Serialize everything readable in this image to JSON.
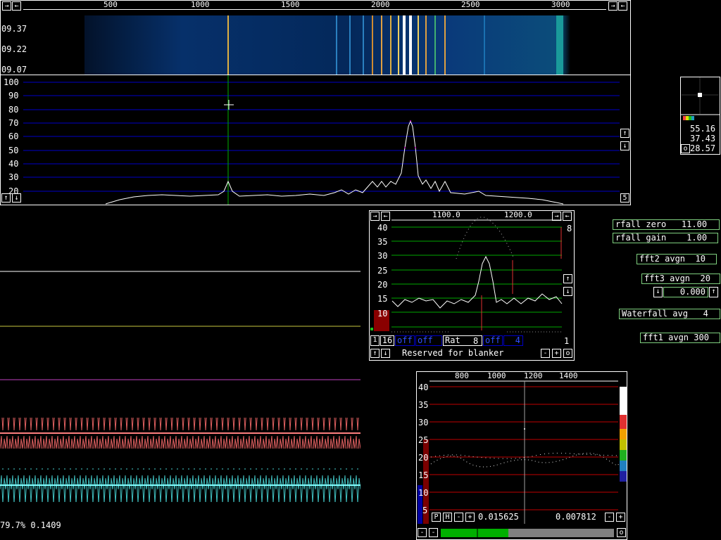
{
  "main_spectrum": {
    "freq_ticks": [
      "500",
      "1000",
      "1500",
      "2000",
      "2500",
      "3000"
    ],
    "time_labels": [
      "09.37",
      "09.22",
      "09.07"
    ],
    "y_ticks": [
      "100",
      "90",
      "80",
      "70",
      "60",
      "50",
      "40",
      "30",
      "20"
    ],
    "avg_label": "5"
  },
  "sidebar_readout": {
    "values": [
      "55.16",
      "37.43",
      "28.57"
    ],
    "o_label": "o"
  },
  "zoom_panel": {
    "freq_ticks": [
      "1100.0",
      "1200.0"
    ],
    "y_ticks": [
      "40",
      "35",
      "30",
      "25",
      "20",
      "15",
      "10"
    ],
    "right_label": "8",
    "controls": [
      "1",
      "16",
      "off",
      "off",
      "Rat",
      "8",
      "off",
      "4"
    ],
    "right_num": "1",
    "blanker_text": "Reserved for blanker",
    "minus": "-",
    "plus": "+",
    "o": "o"
  },
  "parameters": {
    "waterfall_zero": "rfall zero   11.00",
    "waterfall_gain": "rfall gain    1.00",
    "fft2_avgn": "fft2 avgn  10",
    "fft3_avgn": "fft3 avgn  20",
    "value_box": "0.000",
    "waterfall_avg": "Waterfall avg   4",
    "fft1_avgn": "fft1 avgn 300"
  },
  "baseband": {
    "freq_ticks": [
      "800",
      "1000",
      "1200",
      "1400"
    ],
    "y_ticks": [
      "40",
      "35",
      "30",
      "25",
      "20",
      "15",
      "10",
      "5"
    ],
    "p_label": "P",
    "h_label": "H",
    "value_left": "0.015625",
    "value_right": "0.007812",
    "o": "o"
  },
  "status_text": "79.7% 0.1409",
  "colors": {
    "grid_blue": "#0000c8",
    "grid_green": "#00a800",
    "grid_red": "#c00000",
    "frame": "#ffffff",
    "accent_green": "#7fd07f"
  }
}
